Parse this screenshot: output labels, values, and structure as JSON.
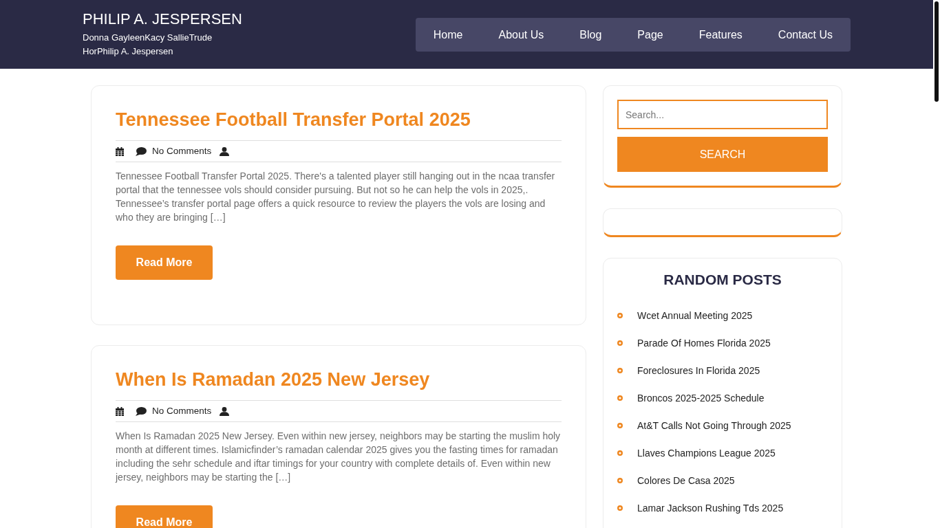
{
  "header": {
    "site_title": "PHILIP A. JESPERSEN",
    "tagline": "Donna GayleenKacy SallieTrude HorPhilip A. Jespersen",
    "nav": [
      "Home",
      "About Us",
      "Blog",
      "Page",
      "Features",
      "Contact Us"
    ]
  },
  "posts": [
    {
      "title": "Tennessee Football Transfer Portal 2025",
      "comments": "No Comments",
      "excerpt": "Tennessee Football Transfer Portal 2025. There's a talented player still hanging out in the ncaa transfer portal that the tennessee vols should consider pursuing. But not so he can help the vols in 2025,. Tennessee’s transfer portal page offers a quick resource to review the players the vols are losing and who they are bringing […]",
      "button": "Read More"
    },
    {
      "title": "When Is Ramadan 2025 New Jersey",
      "comments": "No Comments",
      "excerpt": "When Is Ramadan 2025 New Jersey. Even within new jersey, neighbors may be starting the muslim holy month at different times. Islamicfinder’s ramadan calendar 2025 gives you the fasting times for ramadan including the sehr schedule and iftar timings for your country with complete details of. Even within new jersey, neighbors may be starting the […]",
      "button": "Read More"
    }
  ],
  "sidebar": {
    "search": {
      "placeholder": "Search...",
      "button": "SEARCH"
    },
    "random_posts": {
      "title": "RANDOM POSTS",
      "items": [
        "Wcet Annual Meeting 2025",
        "Parade Of Homes Florida 2025",
        "Foreclosures In Florida 2025",
        "Broncos 2025-2025 Schedule",
        "At&T Calls Not Going Through 2025",
        "Llaves Champions League 2025",
        "Colores De Casa 2025",
        "Lamar Jackson Rushing Tds 2025"
      ]
    }
  }
}
